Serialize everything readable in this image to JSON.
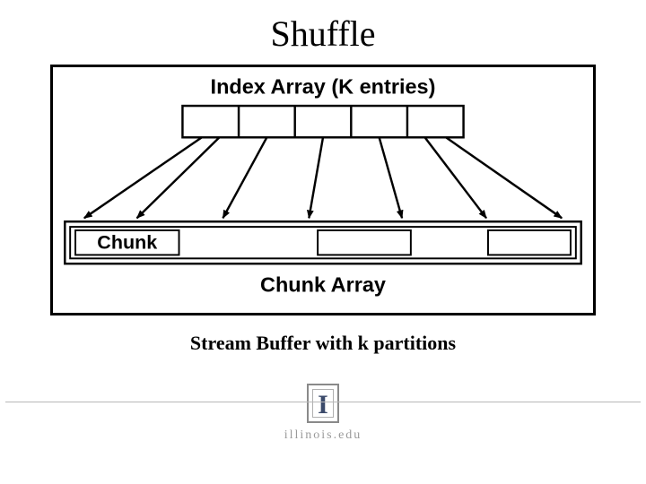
{
  "title": "Shuffle",
  "diagram": {
    "index_label": "Index Array (K entries)",
    "chunk_label": "Chunk",
    "chunk_array_label": "Chunk Array",
    "index_cells": 5,
    "chunk_cells": 3,
    "arrow_count": 7
  },
  "caption": "Stream Buffer with k partitions",
  "footer": {
    "org": "illinois.edu",
    "logo_letter": "I"
  }
}
